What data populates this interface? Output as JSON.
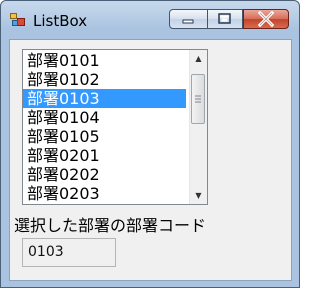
{
  "window": {
    "title": "ListBox"
  },
  "caption_buttons": {
    "minimize": "minimize",
    "maximize": "maximize",
    "close": "close"
  },
  "listbox": {
    "items": [
      "部署0101",
      "部署0102",
      "部署0103",
      "部署0104",
      "部署0105",
      "部署0201",
      "部署0202",
      "部署0203"
    ],
    "selected_index": 2,
    "colors": {
      "selection": "#3399ff"
    }
  },
  "label": "選択した部署の部署コード",
  "code_value": "0103"
}
